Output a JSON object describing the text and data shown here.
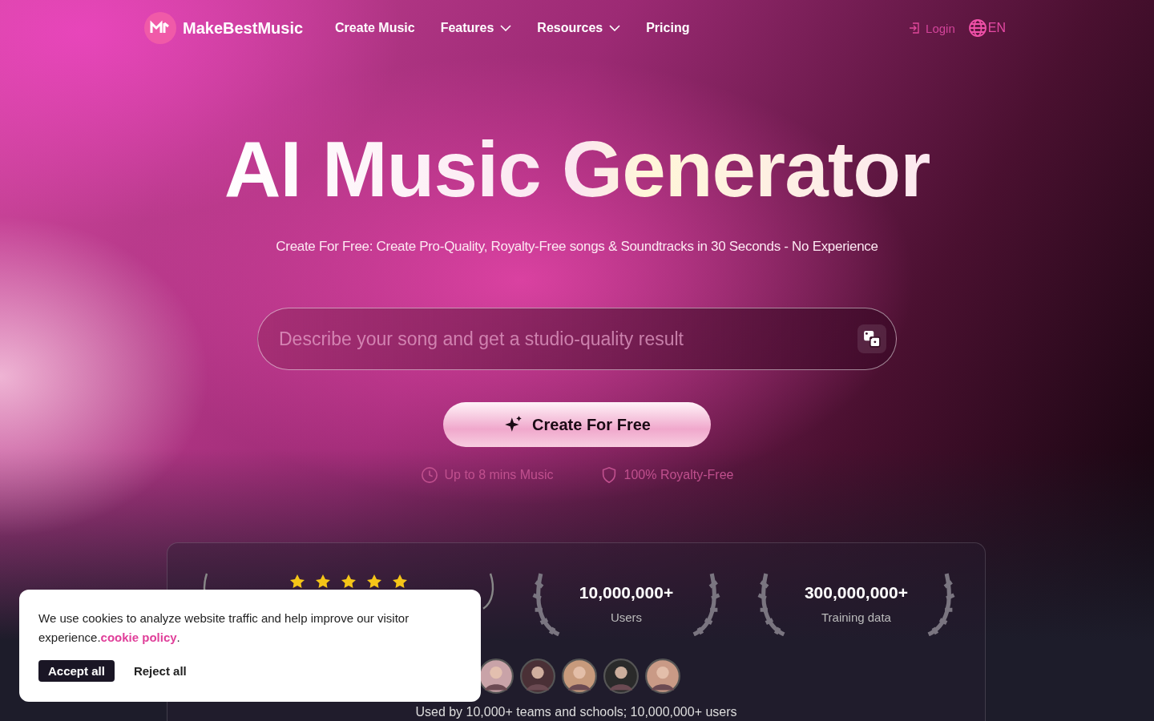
{
  "header": {
    "brand": "MakeBestMusic",
    "nav": [
      {
        "label": "Create Music",
        "kind": "link"
      },
      {
        "label": "Features",
        "kind": "dropdown"
      },
      {
        "label": "Resources",
        "kind": "dropdown"
      },
      {
        "label": "Pricing",
        "kind": "link"
      }
    ],
    "login": "Login",
    "language": "EN"
  },
  "hero": {
    "title": "AI Music Generator",
    "subtitle": "Create For Free: Create Pro-Quality, Royalty-Free songs & Soundtracks in 30 Seconds - No Experience",
    "prompt": {
      "placeholder": "Describe your song and get a studio-quality result"
    },
    "cta": "Create For Free",
    "features": [
      {
        "kind": "clock",
        "label": "Up to 8 mins Music"
      },
      {
        "kind": "shield",
        "label": "100% Royalty-Free"
      }
    ]
  },
  "stats": {
    "rating": {
      "stars": 5
    },
    "items": [
      {
        "value": "10,000,000+",
        "label": "Users"
      },
      {
        "value": "300,000,000+",
        "label": "Training data"
      }
    ],
    "caption": "Used by 10,000+ teams and schools; 10,000,000+ users"
  },
  "cookie": {
    "text": "We use cookies to analyze website traffic and help improve our visitor experience.",
    "link": "cookie policy",
    "end": ".",
    "buttons": [
      {
        "label": "Accept all",
        "kind": "primary"
      },
      {
        "label": "Reject all",
        "kind": "secondary"
      }
    ]
  }
}
